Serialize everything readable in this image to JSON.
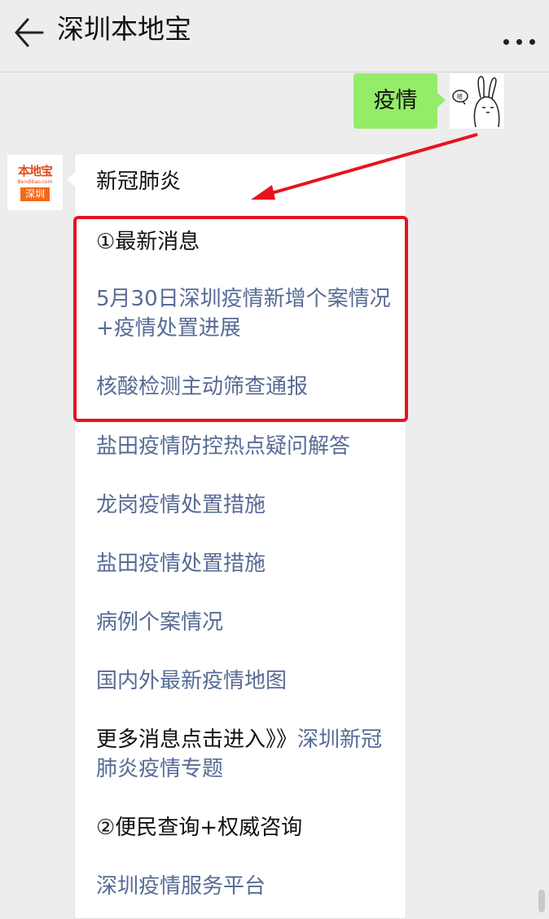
{
  "header": {
    "title": "深圳本地宝",
    "back_icon": "arrow-left-icon",
    "more_icon": "more-horizontal-icon"
  },
  "chat": {
    "user_message": "疫情",
    "bot_avatar": {
      "brand": "本地宝",
      "url": "Bendibao.com",
      "city": "深圳"
    },
    "bot_message": {
      "heading": "新冠肺炎",
      "section1": "①最新消息",
      "item1": "5月30日深圳疫情新增个案情况+疫情处置进展",
      "item2": "核酸检测主动筛查通报",
      "item3": "盐田疫情防控热点疑问解答",
      "item4": "龙岗疫情处置措施",
      "item5": "盐田疫情处置措施",
      "item6": "病例个案情况",
      "item7": "国内外最新疫情地图",
      "more_prefix": "更多消息点击进入》》",
      "more_link": "深圳新冠肺炎疫情专题",
      "section2": "②便民查询+权威咨询",
      "item8": "深圳疫情服务平台"
    }
  },
  "annotation": {
    "color": "#e8131f"
  }
}
